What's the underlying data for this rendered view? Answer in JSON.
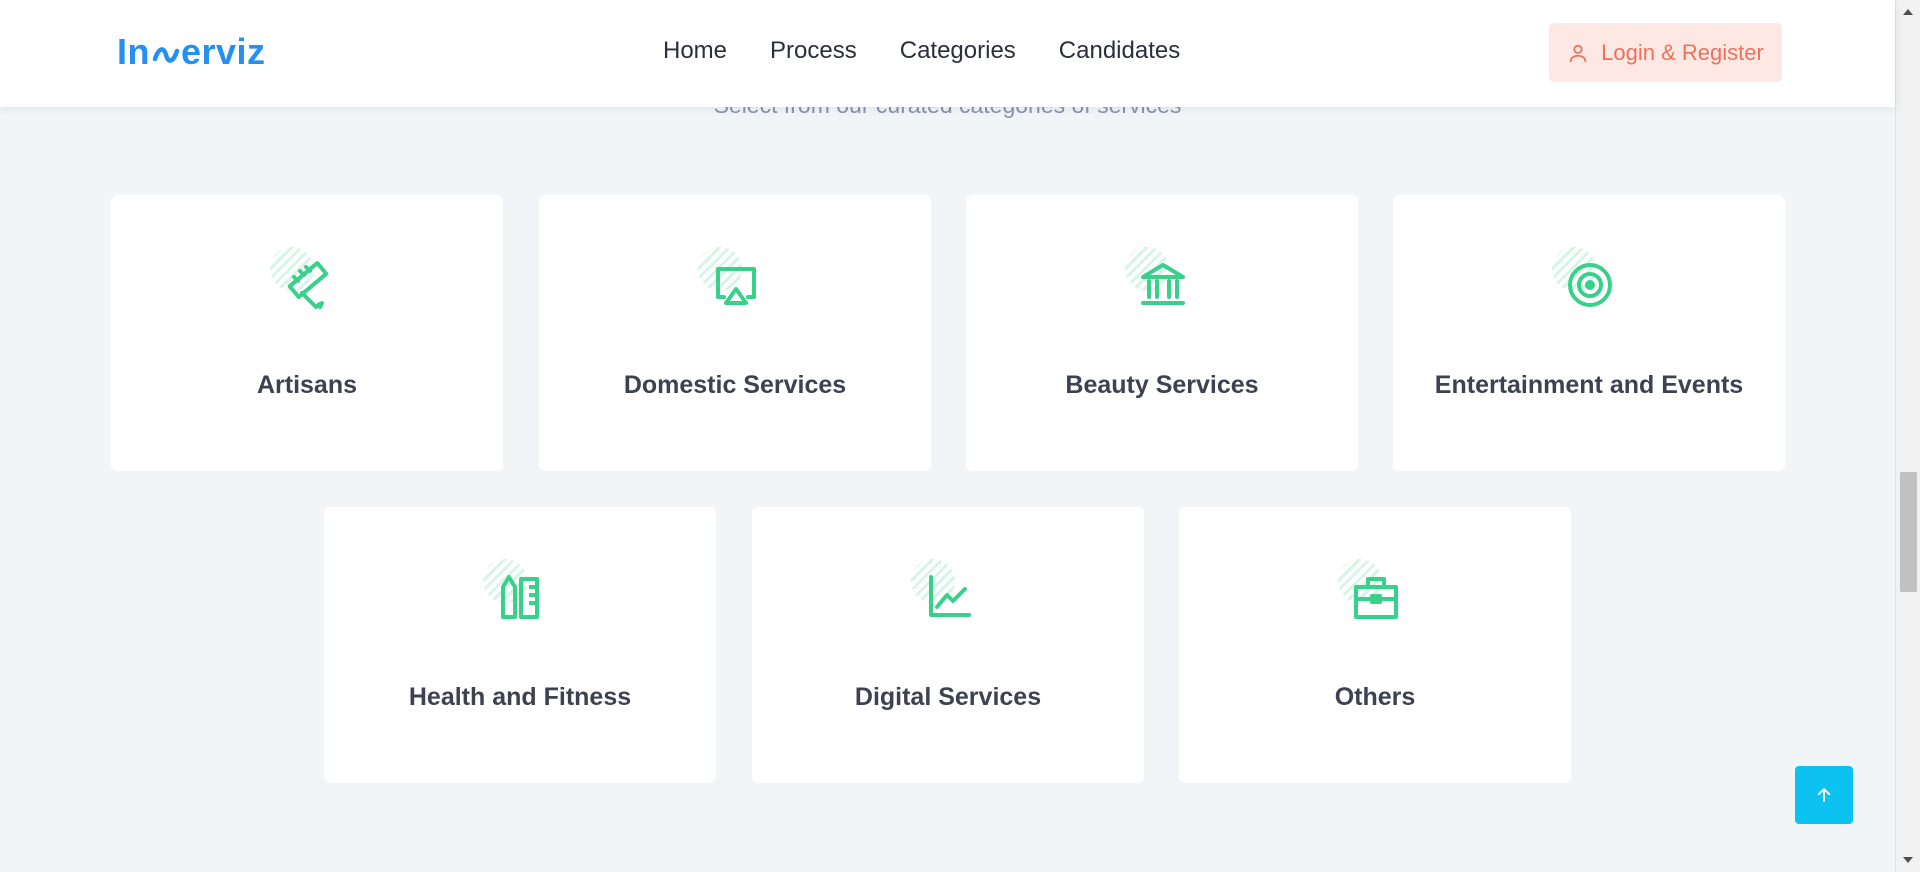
{
  "brand": {
    "logo_prefix": "In",
    "logo_suffix": "erviz",
    "primary_color": "#2390f3",
    "accent_green": "#37d18a",
    "accent_coral": "#f0705b",
    "back_to_top_color": "#0bc2f1"
  },
  "nav": {
    "items": [
      {
        "label": "Home"
      },
      {
        "label": "Process"
      },
      {
        "label": "Categories"
      },
      {
        "label": "Candidates"
      }
    ],
    "login_label": "Login & Register",
    "login_icon": "user-icon"
  },
  "section": {
    "subtitle": "Select from our curated categories of services"
  },
  "categories": [
    {
      "label": "Artisans",
      "icon": "ruler-pencil-icon"
    },
    {
      "label": "Domestic Services",
      "icon": "airplay-icon"
    },
    {
      "label": "Beauty Services",
      "icon": "bank-icon"
    },
    {
      "label": "Entertainment and Events",
      "icon": "target-icon"
    },
    {
      "label": "Health and Fitness",
      "icon": "pencil-ruler-icon"
    },
    {
      "label": "Digital Services",
      "icon": "line-chart-icon"
    },
    {
      "label": "Others",
      "icon": "briefcase-icon"
    }
  ],
  "back_to_top_icon": "arrow-up-icon"
}
